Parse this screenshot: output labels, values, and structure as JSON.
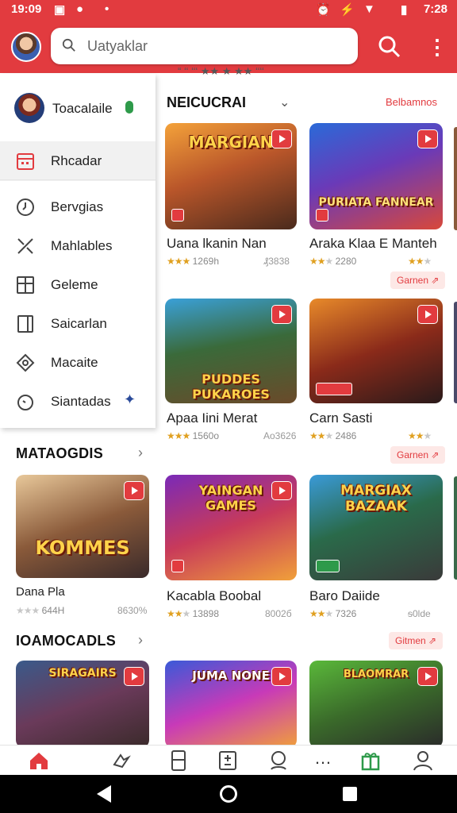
{
  "status_bar": {
    "time": "19:09",
    "right_text": "7:28"
  },
  "search": {
    "placeholder": "Uatyaklar"
  },
  "drawer": {
    "user_name": "Toacalaile",
    "items": [
      {
        "label": "Rhcadar",
        "icon": "calendar-icon",
        "selected": true
      },
      {
        "label": "Bervgias",
        "icon": "clock-icon"
      },
      {
        "label": "Mahlables",
        "icon": "tools-icon"
      },
      {
        "label": "Geleme",
        "icon": "grid-icon"
      },
      {
        "label": "Saicarlan",
        "icon": "panel-icon"
      },
      {
        "label": "Macaite",
        "icon": "tag-icon"
      },
      {
        "label": "Siantadas",
        "icon": "timer-icon"
      }
    ]
  },
  "main": {
    "section_title": "NEICUCRAI",
    "section_link": "Belbamnos",
    "cards": [
      {
        "banner": "MARGIAN",
        "title": "Uana lkanin Nan",
        "rating": 3,
        "reviews": "1269h",
        "meta2": "₰3838",
        "button": ""
      },
      {
        "banner": "PURIATA FANNEAR",
        "title": "Araka Klaa E Manteh",
        "rating": 2,
        "reviews": "2280",
        "meta2": "",
        "button": "Garnen ⇗"
      },
      {
        "banner": "PUDDES PUKAROES",
        "title": "Apaa Iini Merat",
        "rating": 3,
        "reviews": "1560o",
        "meta2": "Ао3626",
        "button": ""
      },
      {
        "banner": "",
        "title": "Carn Sasti",
        "rating": 2,
        "reviews": "2486",
        "meta2": "",
        "button": "Garnen ⇗"
      },
      {
        "banner": "YAINGAN GAMES",
        "title": "Kacabla Boobal",
        "rating": 2,
        "reviews": "13898",
        "meta2": "8002б",
        "button": ""
      },
      {
        "banner": "MARGIAX BAZAAK",
        "title": "Baro Daiide",
        "rating": 2,
        "reviews": "7326",
        "meta2": "ᵴ0lde",
        "button": "Gitmen ⇗"
      },
      {
        "banner": "JUMA NONE",
        "title": "",
        "rating": 0,
        "reviews": "",
        "meta2": "",
        "button": ""
      },
      {
        "banner": "BLAOMRAR",
        "title": "",
        "rating": 0,
        "reviews": "",
        "meta2": "",
        "button": ""
      }
    ]
  },
  "left_sections": [
    {
      "title": "MATAOGDIS",
      "card_banner": "KOMMES",
      "card_title": "Dana Pla",
      "reviews": "644H",
      "meta2": "8630%"
    },
    {
      "title": "IOAMOCADLS",
      "card_banner": "SIRAGAIRS"
    }
  ],
  "bottom_nav": [
    "home-icon",
    "gamepad-icon",
    "storage-icon",
    "apps-icon",
    "search-user-icon",
    "more-icon",
    "gift-icon",
    "profile-icon"
  ],
  "colors": {
    "accent": "#e23b3f"
  }
}
